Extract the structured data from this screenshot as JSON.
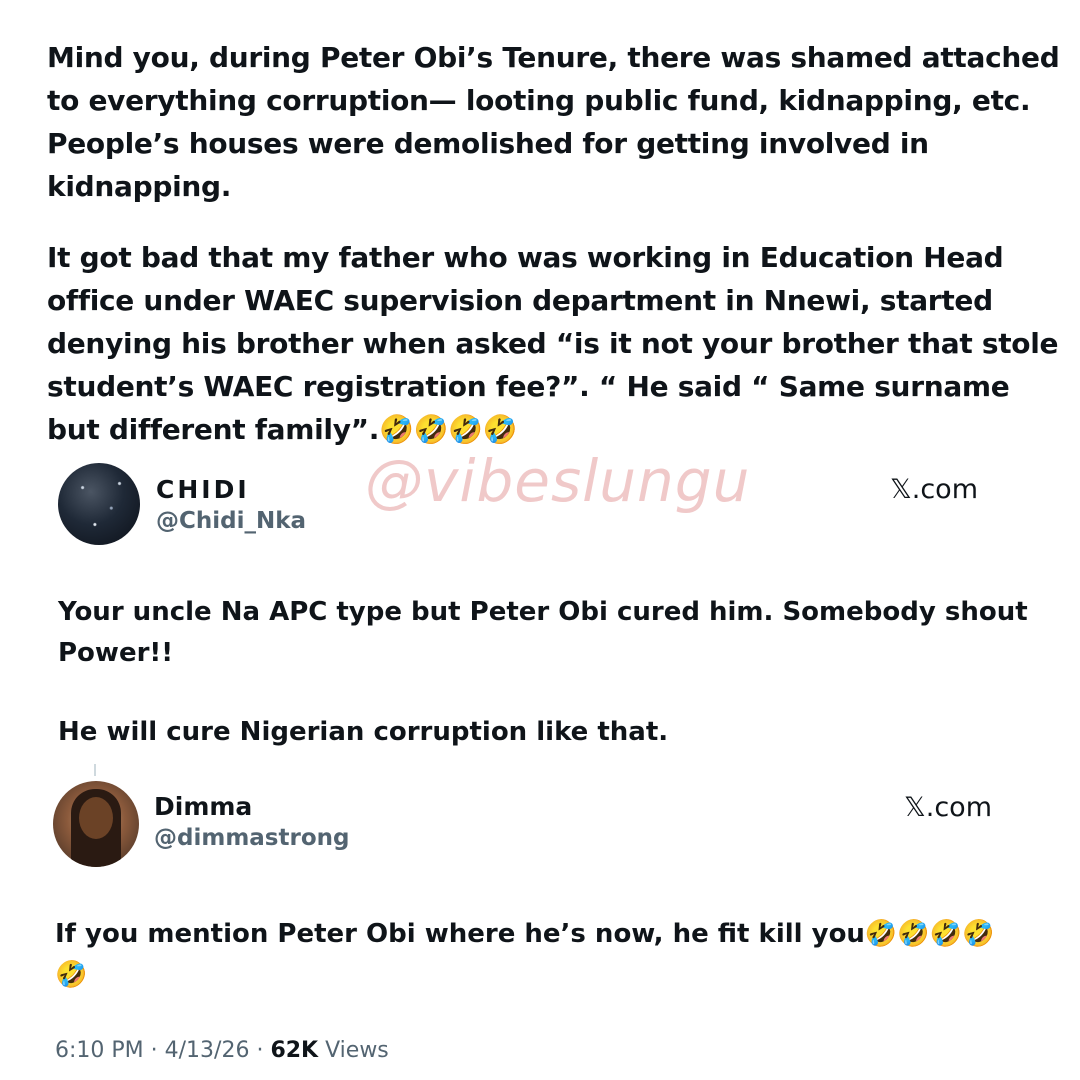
{
  "post": {
    "paragraph_1": "Mind you, during Peter Obi’s Tenure, there was shamed attached to everything corruption— looting public fund, kidnapping, etc. People’s houses were demolished for getting involved in kidnapping.",
    "paragraph_2": "It got bad that my father who was working in Education Head office under WAEC supervision department in Nnewi, started denying his brother when asked “is it not your brother that stole student’s WAEC registration fee?”. “ He said “ Same surname but different family”.🤣🤣🤣🤣"
  },
  "watermark": "@vibeslungu",
  "tweets": [
    {
      "name": "CHIDI",
      "handle": "@Chidi_Nka",
      "source": "𝕏.com",
      "text_1": "Your uncle Na APC type but Peter Obi cured him. Somebody shout Power!!",
      "text_2": "He will cure Nigerian corruption like that."
    },
    {
      "name": "Dimma",
      "handle": "@dimmastrong",
      "source": "𝕏.com",
      "text_1": "If you mention Peter Obi where he’s now, he fit kill you🤣🤣🤣🤣 🤣"
    }
  ],
  "meta": {
    "time": "6:10 PM",
    "sep1": " · ",
    "date": "4/13/26",
    "sep2": " · ",
    "views_count": "62K",
    "views_label": " Views"
  }
}
